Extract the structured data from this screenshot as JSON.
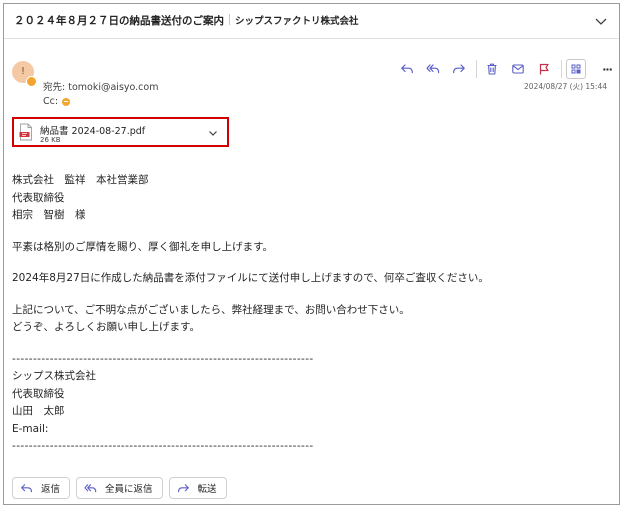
{
  "subject": {
    "title": "２０２４年８月２７日の納品書送付のご案内",
    "sender_org": "シップスファクトリ株式会社"
  },
  "sender": {
    "avatar_initial": "!",
    "to_label": "宛先: ",
    "to_address": "tomoki@aisyo.com",
    "cc_label": "Cc:",
    "date": "2024/08/27 (火) 15:44"
  },
  "toolbar": {
    "icons": [
      "reply-icon",
      "reply-all-icon",
      "forward-icon",
      "delete-icon",
      "mark-unread-icon",
      "flag-icon",
      "apps-icon",
      "more-icon"
    ],
    "more_label": "···"
  },
  "attachment": {
    "name": "納品書 2024-08-27.pdf",
    "size": "26 KB",
    "icon": "pdf-file-icon"
  },
  "body": {
    "line1": "株式会社　監祥　本社営業部",
    "line2": "代表取締役",
    "line3": "相宗　智樹　様",
    "greeting": "平素は格別のご厚情を賜り、厚く御礼を申し上げます。",
    "main": "2024年8月27日に作成した納品書を添付ファイルにて送付申し上げますので、何卒ご査収ください。",
    "inquiry": "上記について、ご不明な点がございましたら、弊社経理まで、お問い合わせ下さい。",
    "closing": "どうぞ、よろしくお願い申し上げます。",
    "divider": "------------------------------------------------------------------------",
    "sig_company": "シップス株式会社",
    "sig_title": "代表取締役",
    "sig_name": "山田　太郎",
    "sig_email": "E-mail:"
  },
  "actions": {
    "reply": "返信",
    "reply_all": "全員に返信",
    "forward": "転送"
  },
  "colors": {
    "accent": "#5b5fc7",
    "flag": "#c4314b",
    "attachment_highlight": "#d10000",
    "avatar_bg": "#f4c9a4",
    "presence": "#f2a52f"
  }
}
